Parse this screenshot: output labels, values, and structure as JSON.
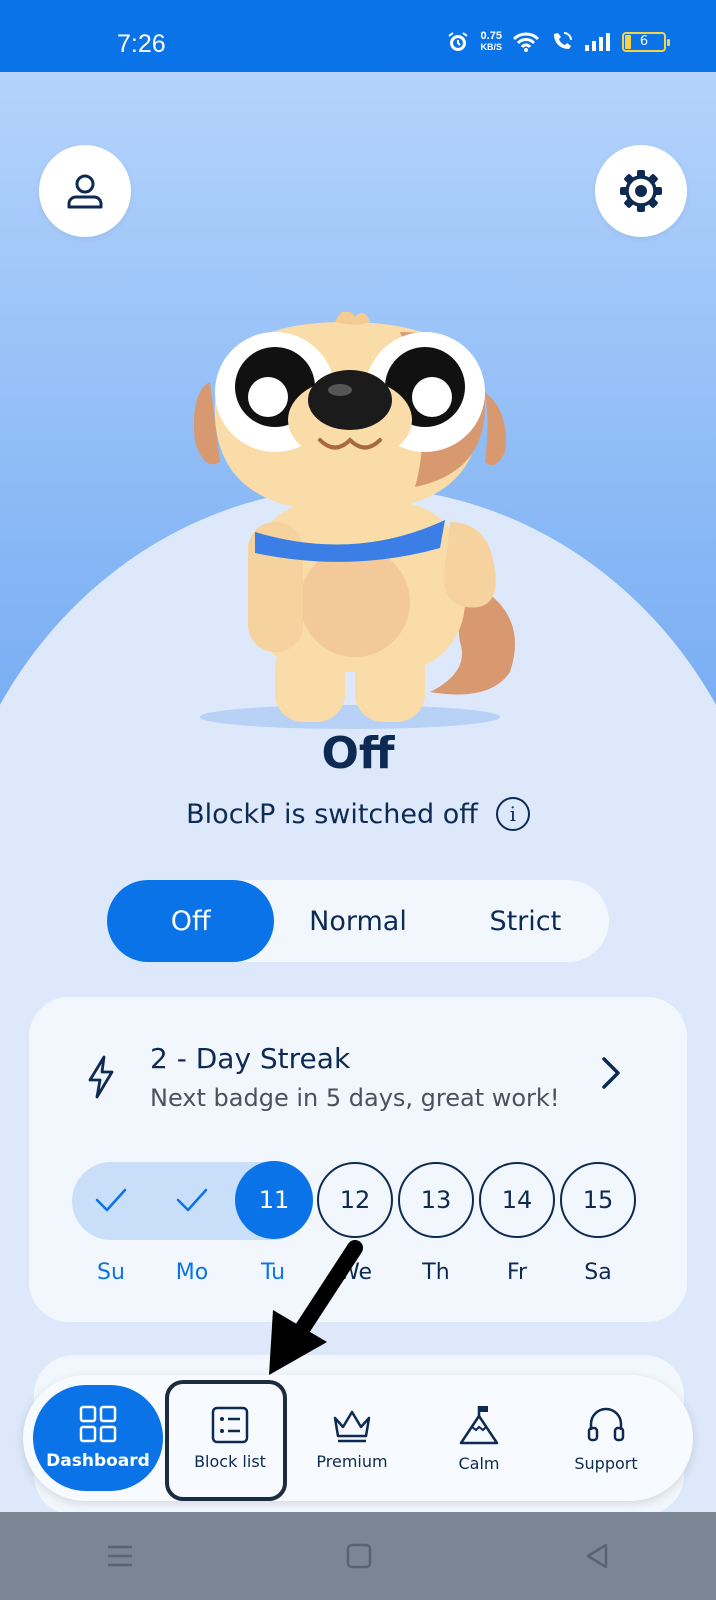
{
  "status_bar": {
    "time": "7:26",
    "net_speed_value": "0.75",
    "net_speed_unit": "KB/S",
    "battery": "6"
  },
  "mode": {
    "title": "Off",
    "subtitle": "BlockP is switched off"
  },
  "segment": {
    "options": [
      "Off",
      "Normal",
      "Strict"
    ],
    "selected": "Off"
  },
  "streak": {
    "title": "2 - Day Streak",
    "subtitle": "Next badge in 5 days, great work!",
    "days": [
      {
        "label": "Su",
        "value": "",
        "state": "done"
      },
      {
        "label": "Mo",
        "value": "",
        "state": "done"
      },
      {
        "label": "Tu",
        "value": "11",
        "state": "today"
      },
      {
        "label": "We",
        "value": "12",
        "state": "upcoming"
      },
      {
        "label": "Th",
        "value": "13",
        "state": "upcoming"
      },
      {
        "label": "Fr",
        "value": "14",
        "state": "upcoming"
      },
      {
        "label": "Sa",
        "value": "15",
        "state": "upcoming"
      }
    ]
  },
  "nav": {
    "items": [
      {
        "label": "Dashboard",
        "icon": "grid-icon"
      },
      {
        "label": "Block list",
        "icon": "list-icon"
      },
      {
        "label": "Premium",
        "icon": "crown-icon"
      },
      {
        "label": "Calm",
        "icon": "mountain-icon"
      },
      {
        "label": "Support",
        "icon": "headset-icon"
      }
    ],
    "active": "Dashboard",
    "highlighted": "Block list"
  },
  "colors": {
    "primary": "#0a73e8",
    "dark_text": "#0d2a52",
    "background": "#dde9fb"
  }
}
